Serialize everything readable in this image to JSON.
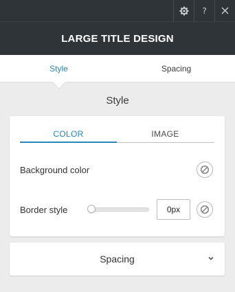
{
  "window": {
    "title": "LARGE TITLE DESIGN",
    "help_label": "?"
  },
  "tabs": [
    {
      "label": "Style",
      "active": true
    },
    {
      "label": "Spacing",
      "active": false
    }
  ],
  "section": {
    "title": "Style"
  },
  "style_card": {
    "subtabs": [
      {
        "label": "COLOR",
        "active": true
      },
      {
        "label": "IMAGE",
        "active": false
      }
    ],
    "background_color_label": "Background color",
    "border_style_label": "Border style",
    "border_width_value": "0px",
    "border_slider_level": 0
  },
  "spacing_accordion": {
    "label": "Spacing"
  },
  "colors": {
    "header_bg": "#2e3438",
    "accent": "#2a86b8",
    "panel_bg": "#ececec"
  },
  "icons": [
    "gear-icon",
    "help-icon",
    "close-icon",
    "none-icon",
    "chevron-down-icon"
  ]
}
